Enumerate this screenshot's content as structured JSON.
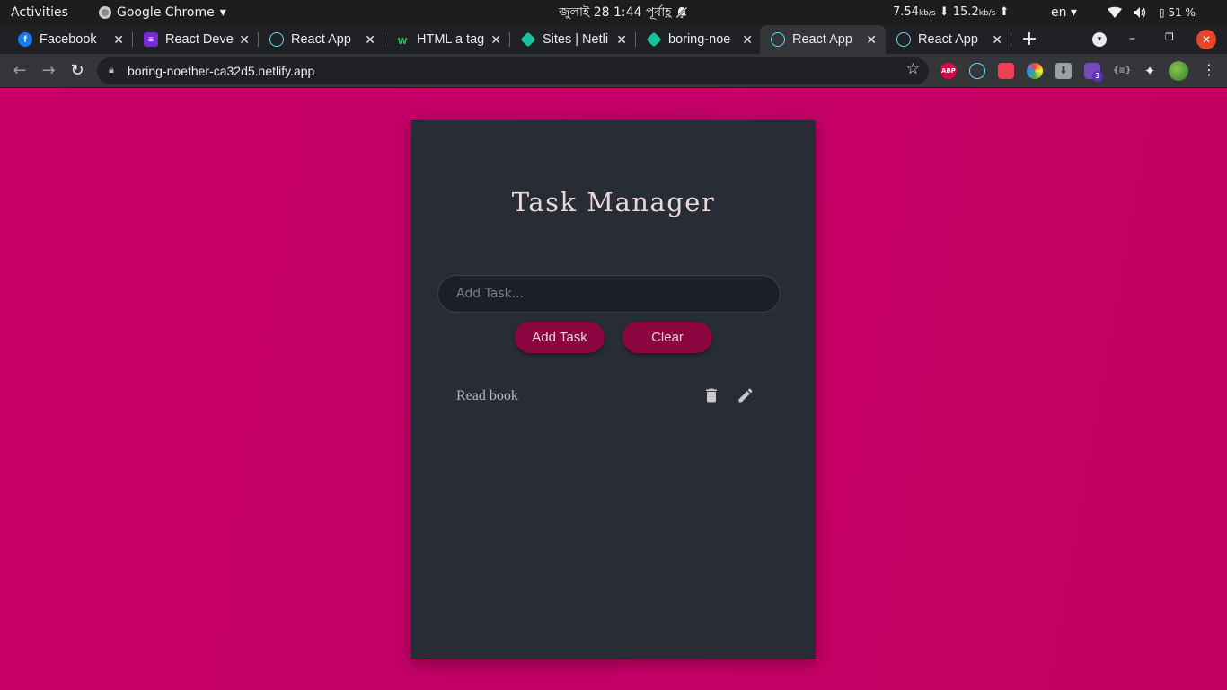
{
  "system_bar": {
    "activities": "Activities",
    "app_name": "Google Chrome",
    "app_menu_arrow": "▾",
    "clock": "জুলাই 28   1:44 পূর্বাহ্ণ",
    "net_down": "7.54",
    "net_down_unit": "kb/s",
    "net_up": "15.2",
    "net_up_unit": "kb/s",
    "language": "en ▾",
    "battery": "51 %",
    "icons": [
      "bell-off-icon",
      "wifi-icon",
      "volume-icon",
      "battery-icon"
    ]
  },
  "tabs": [
    {
      "title": "Facebook",
      "icon": "facebook-icon",
      "active": false
    },
    {
      "title": "React Deve",
      "icon": "list-icon",
      "active": false
    },
    {
      "title": "React App",
      "icon": "react-icon",
      "active": false
    },
    {
      "title": "HTML a tag",
      "icon": "w3schools-icon",
      "active": false
    },
    {
      "title": "Sites | Netli",
      "icon": "netlify-icon",
      "active": false
    },
    {
      "title": "boring-noe",
      "icon": "netlify-icon",
      "active": false
    },
    {
      "title": "React App",
      "icon": "react-icon",
      "active": true
    },
    {
      "title": "React App",
      "icon": "react-icon",
      "active": false
    }
  ],
  "browser": {
    "url": "boring-noether-ca32d5.netlify.app",
    "extensions": [
      "abp-icon",
      "react-devtools-icon",
      "pocket-icon",
      "color-picker-icon",
      "download-icon",
      "redux-devtools-icon",
      "json-viewer-icon",
      "puzzle-icon",
      "profile-avatar"
    ],
    "abp_label": "ABP",
    "redux_badge": "3"
  },
  "app": {
    "title": "Task Manager",
    "input_placeholder": "Add Task...",
    "input_value": "",
    "add_button": "Add Task",
    "clear_button": "Clear",
    "tasks": [
      {
        "text": "Read book"
      }
    ]
  },
  "colors": {
    "page_background": "#c30066",
    "card_background": "#282c35",
    "button_background": "#8b0540"
  }
}
